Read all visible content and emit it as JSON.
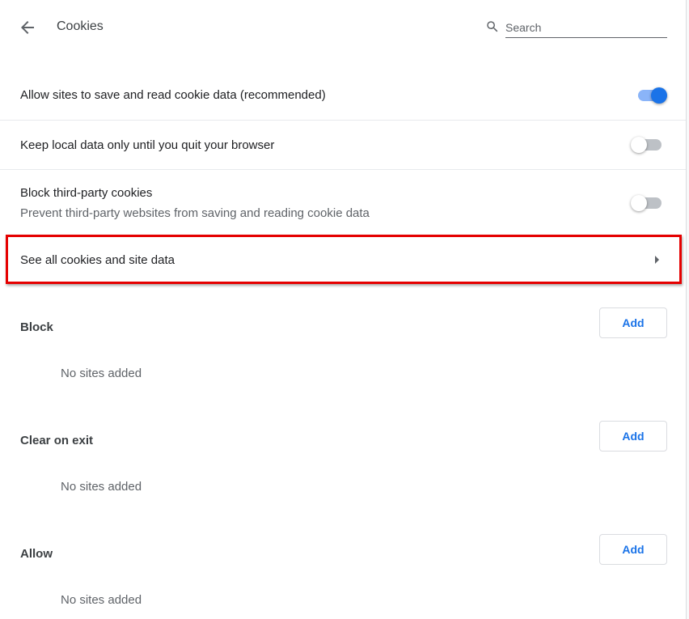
{
  "header": {
    "title": "Cookies",
    "back_icon": "arrow-left-icon",
    "search": {
      "placeholder": "Search",
      "value": "",
      "icon": "search-icon"
    }
  },
  "settings": [
    {
      "label": "Allow sites to save and read cookie data (recommended)",
      "toggle": true
    },
    {
      "label": "Keep local data only until you quit your browser",
      "toggle": false
    },
    {
      "label": "Block third-party cookies",
      "sublabel": "Prevent third-party websites from saving and reading cookie data",
      "toggle": false
    }
  ],
  "link_row": {
    "label": "See all cookies and site data",
    "icon": "arrow-right-icon"
  },
  "highlight_color": "#e50000",
  "accent_color": "#1a73e8",
  "sections": [
    {
      "title": "Block",
      "empty_text": "No sites added",
      "add_label": "Add"
    },
    {
      "title": "Clear on exit",
      "empty_text": "No sites added",
      "add_label": "Add"
    },
    {
      "title": "Allow",
      "empty_text": "No sites added",
      "add_label": "Add"
    }
  ]
}
